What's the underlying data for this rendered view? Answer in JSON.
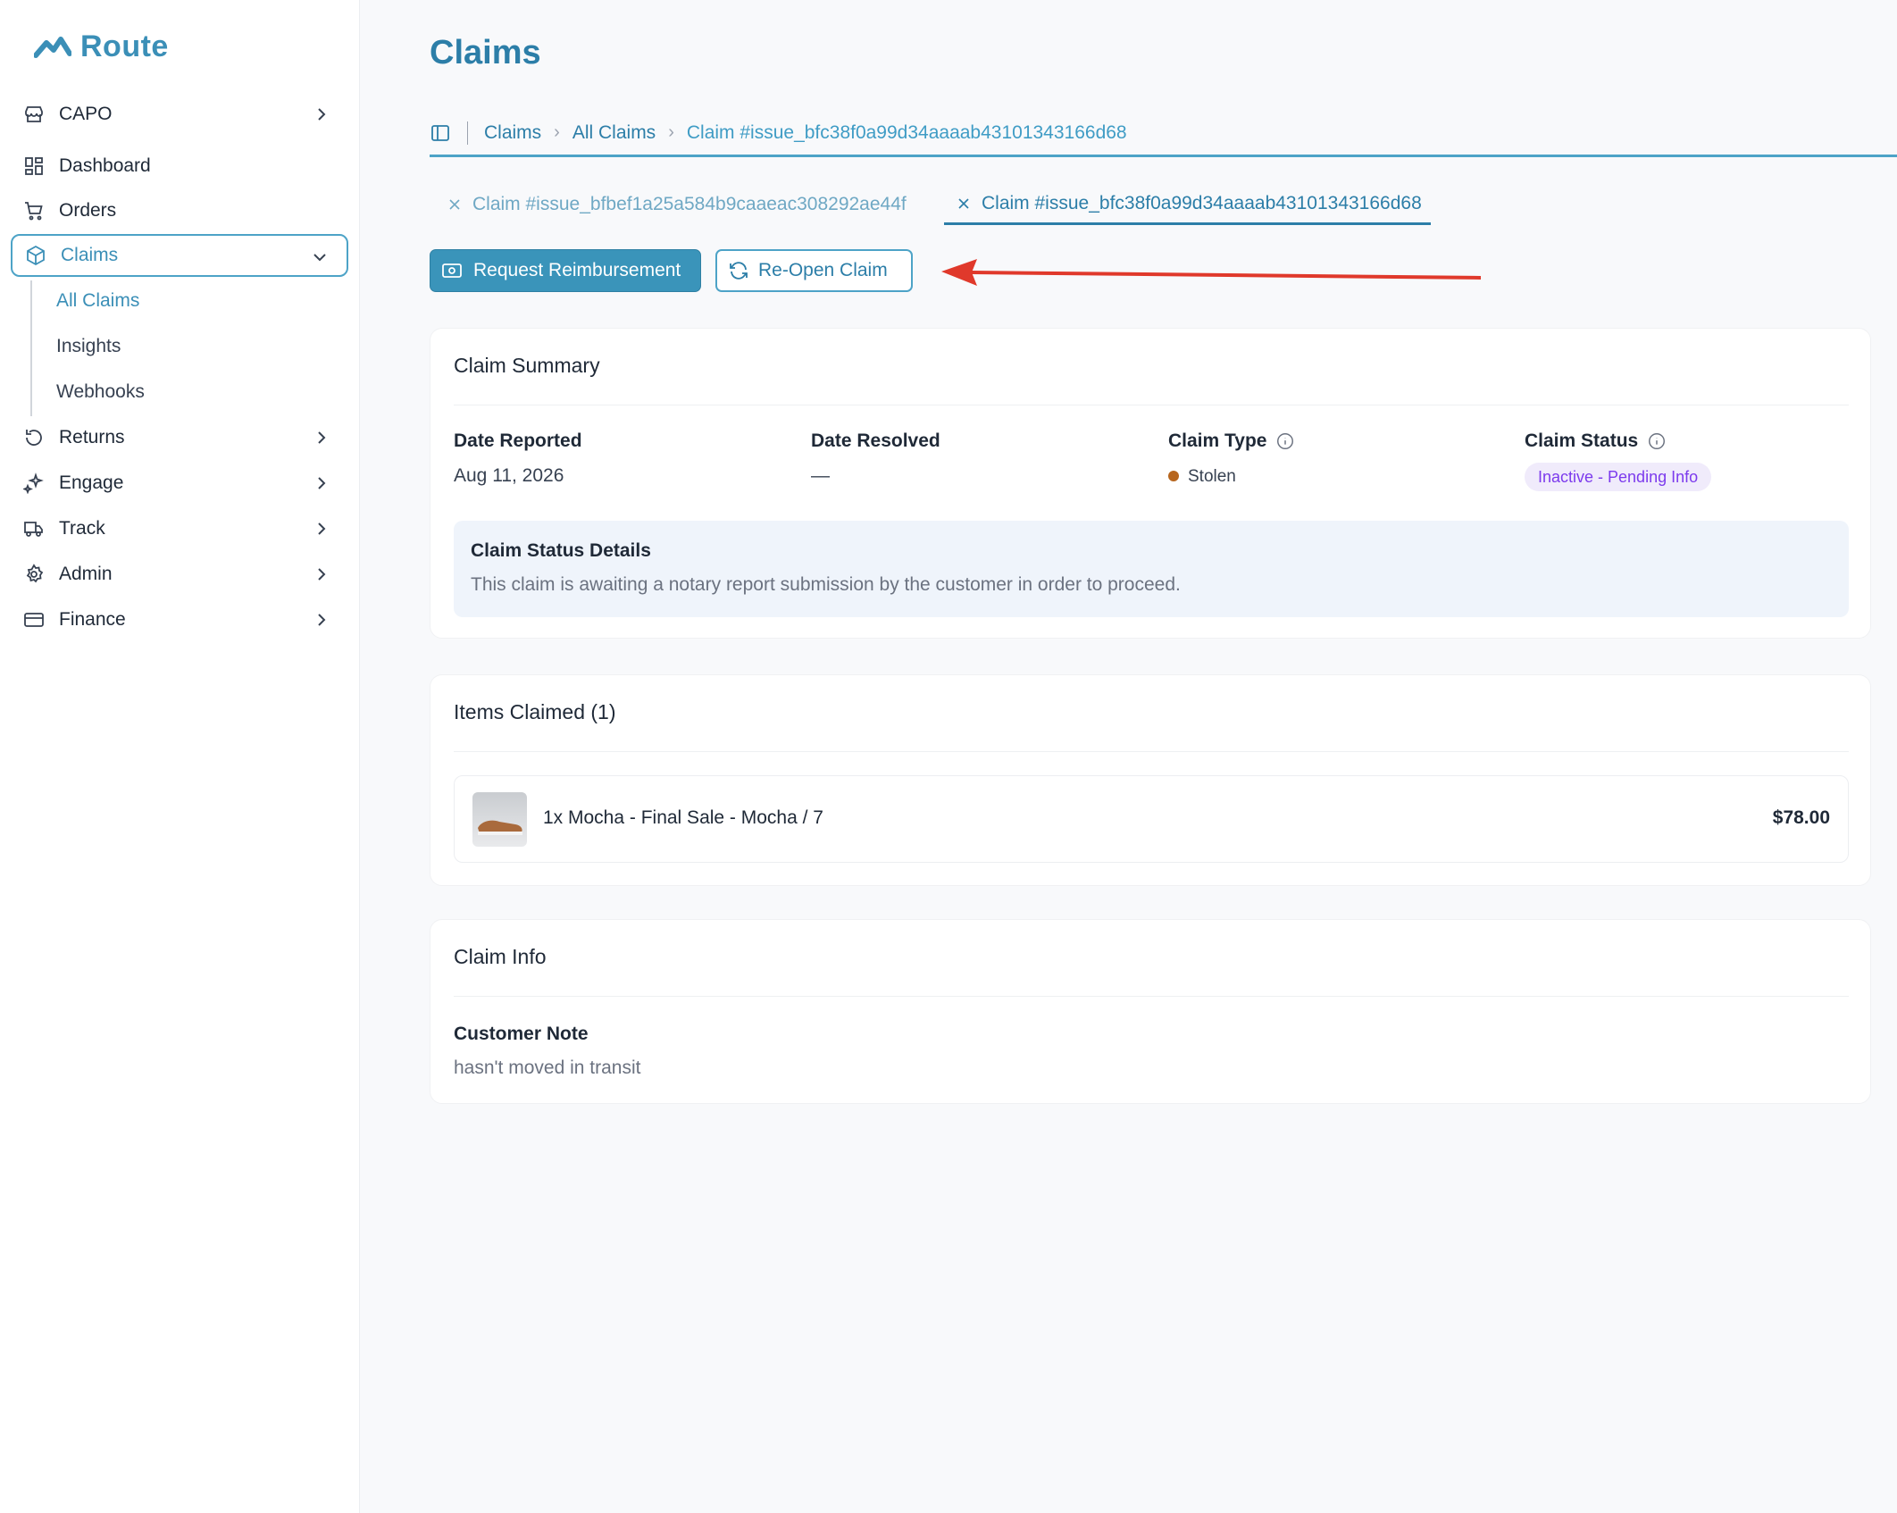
{
  "app": {
    "logo_text": "Route"
  },
  "sidebar": {
    "store": "CAPO",
    "items": [
      {
        "label": "Dashboard",
        "icon": "dashboard-icon"
      },
      {
        "label": "Orders",
        "icon": "cart-icon"
      },
      {
        "label": "Claims",
        "icon": "box-icon",
        "expanded": true,
        "active": true
      },
      {
        "label": "Returns",
        "icon": "rotate-icon"
      },
      {
        "label": "Engage",
        "icon": "sparkle-icon"
      },
      {
        "label": "Track",
        "icon": "truck-icon"
      },
      {
        "label": "Admin",
        "icon": "gear-icon"
      },
      {
        "label": "Finance",
        "icon": "card-icon"
      }
    ],
    "claims_sub": [
      "All Claims",
      "Insights",
      "Webhooks"
    ]
  },
  "header": {
    "title": "Claims",
    "breadcrumb": [
      "Claims",
      "All Claims",
      "Claim #issue_bfc38f0a99d34aaaab43101343166d68"
    ]
  },
  "tabs": [
    {
      "label": "Claim #issue_bfbef1a25a584b9caaeac308292ae44f",
      "active": false
    },
    {
      "label": "Claim #issue_bfc38f0a99d34aaaab43101343166d68",
      "active": true
    }
  ],
  "actions": {
    "request_reimbursement": "Request Reimbursement",
    "reopen_claim": "Re-Open Claim"
  },
  "summary": {
    "title": "Claim Summary",
    "date_reported_label": "Date Reported",
    "date_reported": "Aug 11, 2026",
    "date_resolved_label": "Date Resolved",
    "date_resolved": "—",
    "claim_type_label": "Claim Type",
    "claim_type": "Stolen",
    "claim_status_label": "Claim Status",
    "claim_status": "Inactive - Pending Info",
    "details_title": "Claim Status Details",
    "details_text": "This claim is awaiting a notary report submission by the customer in order to proceed."
  },
  "items": {
    "title": "Items Claimed (1)",
    "list": [
      {
        "name": "1x Mocha - Final Sale - Mocha / 7",
        "price": "$78.00"
      }
    ]
  },
  "claim_info": {
    "title": "Claim Info",
    "note_label": "Customer Note",
    "note": "hasn't moved in transit"
  },
  "colors": {
    "brand": "#3b8fb7",
    "primary_button": "#3a94ba",
    "status_pill_bg": "#f0ebfb",
    "status_pill_text": "#7c3aed",
    "annotation_arrow": "#e0392b"
  }
}
